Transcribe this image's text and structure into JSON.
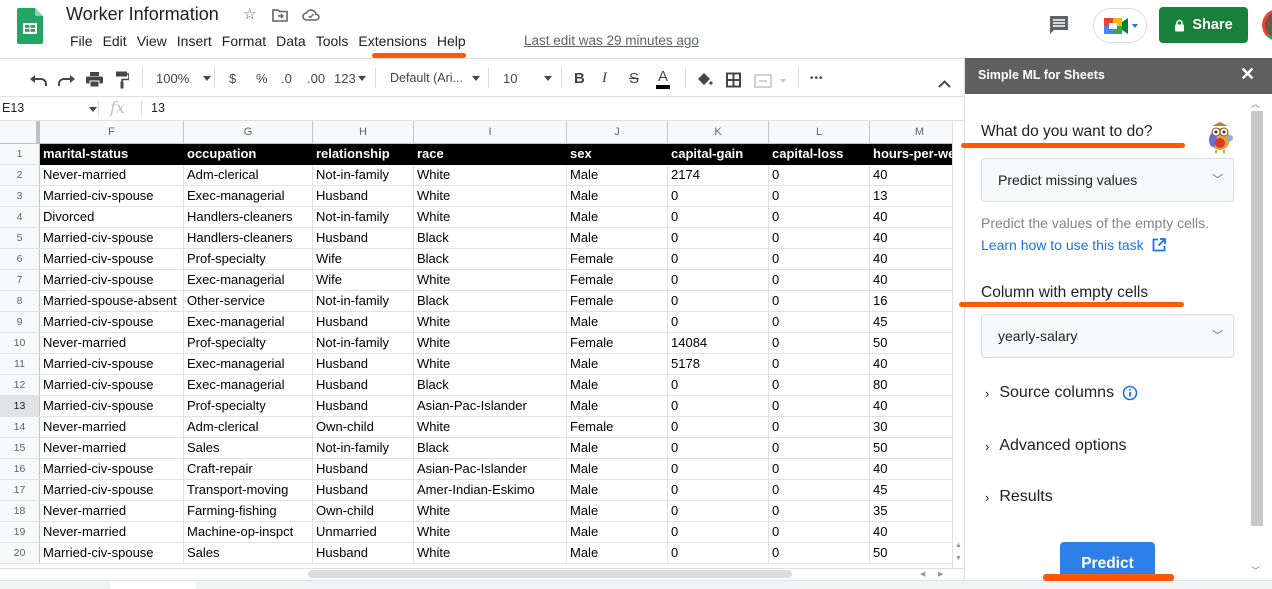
{
  "header": {
    "title": "Worker Information",
    "menu": [
      "File",
      "Edit",
      "View",
      "Insert",
      "Format",
      "Data",
      "Tools",
      "Extensions",
      "Help"
    ],
    "last_edit": "Last edit was 29 minutes ago",
    "share_label": "Share",
    "colors": {
      "share": "#188038",
      "annotation": "#ff5a00"
    }
  },
  "toolbar": {
    "zoom": "100%",
    "currency": "$",
    "percent": "%",
    "decrease_decimal": ".0",
    "increase_decimal": ".00",
    "format_more": "123",
    "font": "Default (Ari...",
    "font_size": "10",
    "bold": "B",
    "italic": "I",
    "strike": "S",
    "text_color": "A",
    "more": "•••"
  },
  "formula_bar": {
    "cell_ref": "E13",
    "fx": "fx",
    "value": "13"
  },
  "grid": {
    "columns": [
      "F",
      "G",
      "H",
      "I",
      "J",
      "K",
      "L",
      "M"
    ],
    "headers": [
      "marital-status",
      "occupation",
      "relationship",
      "race",
      "sex",
      "capital-gain",
      "capital-loss",
      "hours-per-week"
    ],
    "rows": [
      {
        "n": "2",
        "cells": [
          "Never-married",
          "Adm-clerical",
          "Not-in-family",
          "White",
          "Male",
          "2174",
          "0",
          "40"
        ]
      },
      {
        "n": "3",
        "cells": [
          "Married-civ-spouse",
          "Exec-managerial",
          "Husband",
          "White",
          "Male",
          "0",
          "0",
          "13"
        ]
      },
      {
        "n": "4",
        "cells": [
          "Divorced",
          "Handlers-cleaners",
          "Not-in-family",
          "White",
          "Male",
          "0",
          "0",
          "40"
        ]
      },
      {
        "n": "5",
        "cells": [
          "Married-civ-spouse",
          "Handlers-cleaners",
          "Husband",
          "Black",
          "Male",
          "0",
          "0",
          "40"
        ]
      },
      {
        "n": "6",
        "cells": [
          "Married-civ-spouse",
          "Prof-specialty",
          "Wife",
          "Black",
          "Female",
          "0",
          "0",
          "40"
        ]
      },
      {
        "n": "7",
        "cells": [
          "Married-civ-spouse",
          "Exec-managerial",
          "Wife",
          "White",
          "Female",
          "0",
          "0",
          "40"
        ]
      },
      {
        "n": "8",
        "cells": [
          "Married-spouse-absent",
          "Other-service",
          "Not-in-family",
          "Black",
          "Female",
          "0",
          "0",
          "16"
        ]
      },
      {
        "n": "9",
        "cells": [
          "Married-civ-spouse",
          "Exec-managerial",
          "Husband",
          "White",
          "Male",
          "0",
          "0",
          "45"
        ]
      },
      {
        "n": "10",
        "cells": [
          "Never-married",
          "Prof-specialty",
          "Not-in-family",
          "White",
          "Female",
          "14084",
          "0",
          "50"
        ]
      },
      {
        "n": "11",
        "cells": [
          "Married-civ-spouse",
          "Exec-managerial",
          "Husband",
          "White",
          "Male",
          "5178",
          "0",
          "40"
        ]
      },
      {
        "n": "12",
        "cells": [
          "Married-civ-spouse",
          "Exec-managerial",
          "Husband",
          "Black",
          "Male",
          "0",
          "0",
          "80"
        ]
      },
      {
        "n": "13",
        "cells": [
          "Married-civ-spouse",
          "Prof-specialty",
          "Husband",
          "Asian-Pac-Islander",
          "Male",
          "0",
          "0",
          "40"
        ]
      },
      {
        "n": "14",
        "cells": [
          "Never-married",
          "Adm-clerical",
          "Own-child",
          "White",
          "Female",
          "0",
          "0",
          "30"
        ]
      },
      {
        "n": "15",
        "cells": [
          "Never-married",
          "Sales",
          "Not-in-family",
          "Black",
          "Male",
          "0",
          "0",
          "50"
        ]
      },
      {
        "n": "16",
        "cells": [
          "Married-civ-spouse",
          "Craft-repair",
          "Husband",
          "Asian-Pac-Islander",
          "Male",
          "0",
          "0",
          "40"
        ]
      },
      {
        "n": "17",
        "cells": [
          "Married-civ-spouse",
          "Transport-moving",
          "Husband",
          "Amer-Indian-Eskimo",
          "Male",
          "0",
          "0",
          "45"
        ]
      },
      {
        "n": "18",
        "cells": [
          "Never-married",
          "Farming-fishing",
          "Own-child",
          "White",
          "Male",
          "0",
          "0",
          "35"
        ]
      },
      {
        "n": "19",
        "cells": [
          "Never-married",
          "Machine-op-inspct",
          "Unmarried",
          "White",
          "Male",
          "0",
          "0",
          "40"
        ]
      },
      {
        "n": "20",
        "cells": [
          "Married-civ-spouse",
          "Sales",
          "Husband",
          "White",
          "Male",
          "0",
          "0",
          "50"
        ]
      }
    ],
    "selected_row": "13"
  },
  "sidebar": {
    "title": "Simple ML for Sheets",
    "close": "✕",
    "task_label": "What do you want to do?",
    "task_value": "Predict missing values",
    "task_description": "Predict the values of the empty cells.",
    "learn_link": "Learn how to use this task",
    "column_label": "Column with empty cells",
    "column_value": "yearly-salary",
    "sections": [
      "Source columns",
      "Advanced options",
      "Results"
    ],
    "predict_label": "Predict",
    "colors": {
      "header": "#5f5f5f",
      "predict": "#2f7fe8",
      "link": "#1a73e8"
    }
  }
}
